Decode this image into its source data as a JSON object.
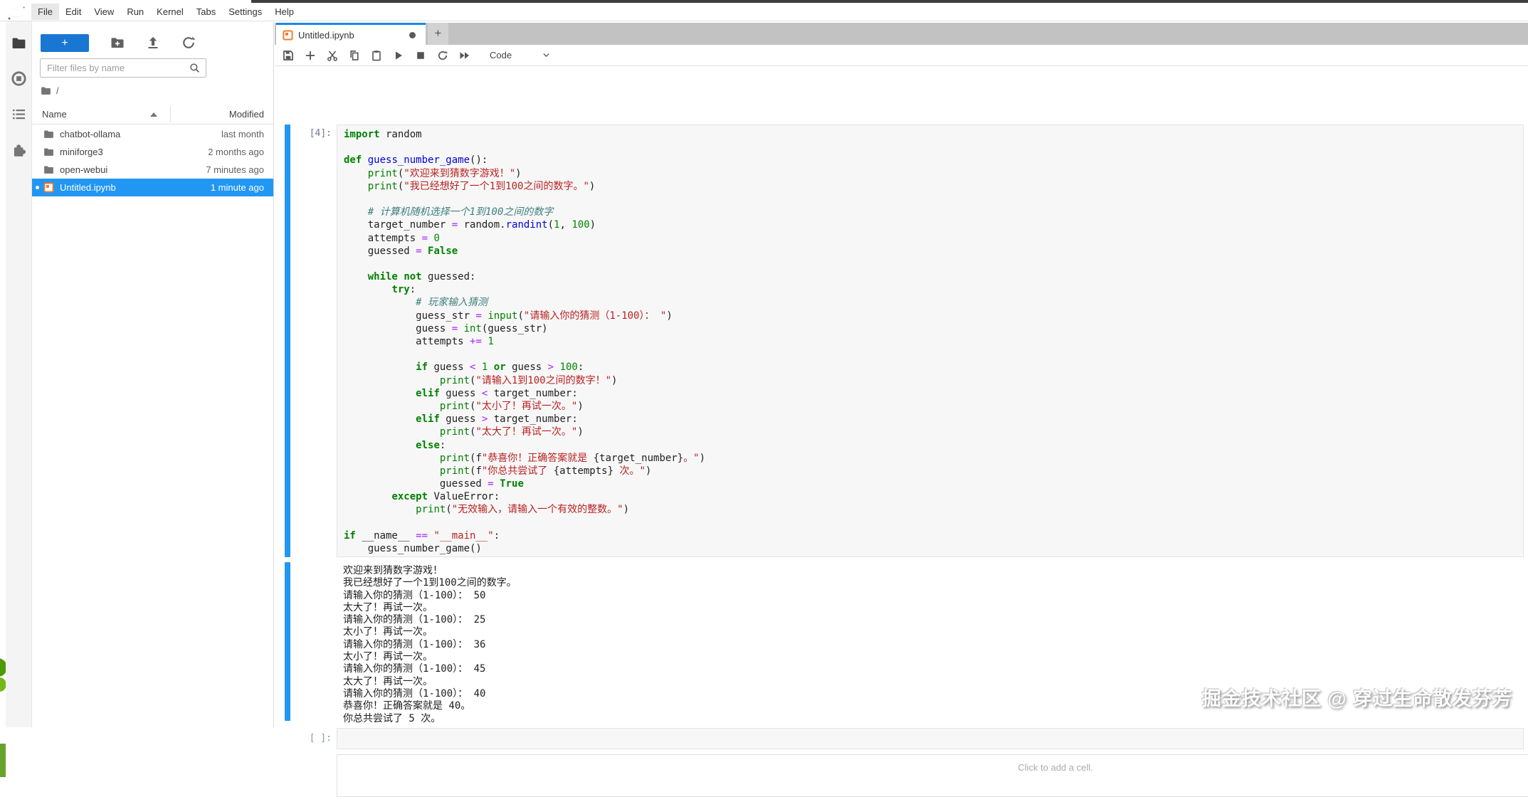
{
  "menu_bar": {
    "items": [
      "File",
      "Edit",
      "View",
      "Run",
      "Kernel",
      "Tabs",
      "Settings",
      "Help"
    ],
    "active_item": "File"
  },
  "activity_bar": {
    "icons": [
      {
        "name": "file-browser-icon",
        "glyph": "folder",
        "active": true
      },
      {
        "name": "running-kernels-icon",
        "glyph": "stop-circle",
        "active": false
      },
      {
        "name": "table-of-contents-icon",
        "glyph": "toc",
        "active": false
      },
      {
        "name": "extensions-icon",
        "glyph": "puzzle",
        "active": false
      }
    ]
  },
  "file_browser": {
    "new_launcher_label": "+",
    "action_icons": [
      "new-folder",
      "upload",
      "refresh"
    ],
    "filter_placeholder": "Filter files by name",
    "breadcrumb": "/",
    "columns": {
      "name": "Name",
      "modified": "Modified"
    },
    "files": [
      {
        "name": "chatbot-ollama",
        "modified": "last month",
        "type": "folder",
        "selected": false,
        "running": false
      },
      {
        "name": "miniforge3",
        "modified": "2 months ago",
        "type": "folder",
        "selected": false,
        "running": false
      },
      {
        "name": "open-webui",
        "modified": "7 minutes ago",
        "type": "folder",
        "selected": false,
        "running": false
      },
      {
        "name": "Untitled.ipynb",
        "modified": "1 minute ago",
        "type": "notebook",
        "selected": true,
        "running": true
      }
    ]
  },
  "tab_bar": {
    "tabs": [
      {
        "label": "Untitled.ipynb",
        "dirty": true,
        "active": true
      }
    ],
    "new_tab_label": "+"
  },
  "notebook_toolbar": {
    "icons": [
      "save",
      "insert-cell",
      "cut",
      "copy",
      "paste",
      "run",
      "interrupt",
      "restart",
      "restart-run-all"
    ],
    "cell_type": "Code"
  },
  "notebook": {
    "execution_count": "[4]:",
    "empty_prompt": "[ ]:",
    "add_cell_hint": "Click to add a cell.",
    "code_lines": [
      [
        [
          "k",
          "import"
        ],
        [
          "v",
          " random"
        ]
      ],
      [],
      [
        [
          "k",
          "def"
        ],
        [
          "v",
          " "
        ],
        [
          "f",
          "guess_number_game"
        ],
        [
          "v",
          "():"
        ]
      ],
      [
        [
          "v",
          "    "
        ],
        [
          "b",
          "print"
        ],
        [
          "v",
          "("
        ],
        [
          "s",
          "\"欢迎来到猜数字游戏！\""
        ],
        [
          "v",
          ")"
        ]
      ],
      [
        [
          "v",
          "    "
        ],
        [
          "b",
          "print"
        ],
        [
          "v",
          "("
        ],
        [
          "s",
          "\"我已经想好了一个1到100之间的数字。\""
        ],
        [
          "v",
          ")"
        ]
      ],
      [],
      [
        [
          "v",
          "    "
        ],
        [
          "c",
          "# 计算机随机选择一个1到100之间的数字"
        ]
      ],
      [
        [
          "v",
          "    target_number "
        ],
        [
          "o",
          "="
        ],
        [
          "v",
          " random."
        ],
        [
          "f",
          "randint"
        ],
        [
          "v",
          "("
        ],
        [
          "n",
          "1"
        ],
        [
          "v",
          ", "
        ],
        [
          "n",
          "100"
        ],
        [
          "v",
          ")"
        ]
      ],
      [
        [
          "v",
          "    attempts "
        ],
        [
          "o",
          "="
        ],
        [
          "v",
          " "
        ],
        [
          "n",
          "0"
        ]
      ],
      [
        [
          "v",
          "    guessed "
        ],
        [
          "o",
          "="
        ],
        [
          "v",
          " "
        ],
        [
          "k",
          "False"
        ]
      ],
      [],
      [
        [
          "v",
          "    "
        ],
        [
          "k",
          "while"
        ],
        [
          "v",
          " "
        ],
        [
          "k",
          "not"
        ],
        [
          "v",
          " guessed:"
        ]
      ],
      [
        [
          "v",
          "        "
        ],
        [
          "k",
          "try"
        ],
        [
          "v",
          ":"
        ]
      ],
      [
        [
          "v",
          "            "
        ],
        [
          "c",
          "# 玩家输入猜测"
        ]
      ],
      [
        [
          "v",
          "            guess_str "
        ],
        [
          "o",
          "="
        ],
        [
          "v",
          " "
        ],
        [
          "b",
          "input"
        ],
        [
          "v",
          "("
        ],
        [
          "s",
          "\"请输入你的猜测（1-100）： \""
        ],
        [
          "v",
          ")"
        ]
      ],
      [
        [
          "v",
          "            guess "
        ],
        [
          "o",
          "="
        ],
        [
          "v",
          " "
        ],
        [
          "b",
          "int"
        ],
        [
          "v",
          "(guess_str)"
        ]
      ],
      [
        [
          "v",
          "            attempts "
        ],
        [
          "o",
          "+="
        ],
        [
          "v",
          " "
        ],
        [
          "n",
          "1"
        ]
      ],
      [],
      [
        [
          "v",
          "            "
        ],
        [
          "k",
          "if"
        ],
        [
          "v",
          " guess "
        ],
        [
          "o",
          "<"
        ],
        [
          "v",
          " "
        ],
        [
          "n",
          "1"
        ],
        [
          "v",
          " "
        ],
        [
          "k",
          "or"
        ],
        [
          "v",
          " guess "
        ],
        [
          "o",
          ">"
        ],
        [
          "v",
          " "
        ],
        [
          "n",
          "100"
        ],
        [
          "v",
          ":"
        ]
      ],
      [
        [
          "v",
          "                "
        ],
        [
          "b",
          "print"
        ],
        [
          "v",
          "("
        ],
        [
          "s",
          "\"请输入1到100之间的数字！\""
        ],
        [
          "v",
          ")"
        ]
      ],
      [
        [
          "v",
          "            "
        ],
        [
          "k",
          "elif"
        ],
        [
          "v",
          " guess "
        ],
        [
          "o",
          "<"
        ],
        [
          "v",
          " target_number:"
        ]
      ],
      [
        [
          "v",
          "                "
        ],
        [
          "b",
          "print"
        ],
        [
          "v",
          "("
        ],
        [
          "s",
          "\"太小了！再试一次。\""
        ],
        [
          "v",
          ")"
        ]
      ],
      [
        [
          "v",
          "            "
        ],
        [
          "k",
          "elif"
        ],
        [
          "v",
          " guess "
        ],
        [
          "o",
          ">"
        ],
        [
          "v",
          " target_number:"
        ]
      ],
      [
        [
          "v",
          "                "
        ],
        [
          "b",
          "print"
        ],
        [
          "v",
          "("
        ],
        [
          "s",
          "\"太大了！再试一次。\""
        ],
        [
          "v",
          ")"
        ]
      ],
      [
        [
          "v",
          "            "
        ],
        [
          "k",
          "else"
        ],
        [
          "v",
          ":"
        ]
      ],
      [
        [
          "v",
          "                "
        ],
        [
          "b",
          "print"
        ],
        [
          "v",
          "(f"
        ],
        [
          "s",
          "\"恭喜你！正确答案就是 "
        ],
        [
          "v",
          "{target_number}"
        ],
        [
          "s",
          "。\""
        ],
        [
          "v",
          ")"
        ]
      ],
      [
        [
          "v",
          "                "
        ],
        [
          "b",
          "print"
        ],
        [
          "v",
          "(f"
        ],
        [
          "s",
          "\"你总共尝试了 "
        ],
        [
          "v",
          "{attempts}"
        ],
        [
          "s",
          " 次。\""
        ],
        [
          "v",
          ")"
        ]
      ],
      [
        [
          "v",
          "                guessed "
        ],
        [
          "o",
          "="
        ],
        [
          "v",
          " "
        ],
        [
          "k",
          "True"
        ]
      ],
      [
        [
          "v",
          "        "
        ],
        [
          "k",
          "except"
        ],
        [
          "v",
          " ValueError:"
        ]
      ],
      [
        [
          "v",
          "            "
        ],
        [
          "b",
          "print"
        ],
        [
          "v",
          "("
        ],
        [
          "s",
          "\"无效输入，请输入一个有效的整数。\""
        ],
        [
          "v",
          ")"
        ]
      ],
      [],
      [
        [
          "k",
          "if"
        ],
        [
          "v",
          " __name__ "
        ],
        [
          "o",
          "=="
        ],
        [
          "v",
          " "
        ],
        [
          "s",
          "\"__main__\""
        ],
        [
          "v",
          ":"
        ]
      ],
      [
        [
          "v",
          "    guess_number_game()"
        ]
      ]
    ],
    "output_lines": [
      "欢迎来到猜数字游戏！",
      "我已经想好了一个1到100之间的数字。",
      "请输入你的猜测（1-100）： 50",
      "太大了！再试一次。",
      "请输入你的猜测（1-100）： 25",
      "太小了！再试一次。",
      "请输入你的猜测（1-100）： 36",
      "太小了！再试一次。",
      "请输入你的猜测（1-100）： 45",
      "太大了！再试一次。",
      "请输入你的猜测（1-100）： 40",
      "恭喜你！正确答案就是 40。",
      "你总共尝试了 5 次。"
    ]
  },
  "watermark": "掘金技术社区 @ 穿过生命散发芬芳",
  "colors": {
    "accent": "#1e88e5",
    "selection": "#2196f3",
    "brand_orange": "#f37726",
    "tab_strip": "#c2c2c2",
    "cell_background": "#f7f7f7"
  }
}
